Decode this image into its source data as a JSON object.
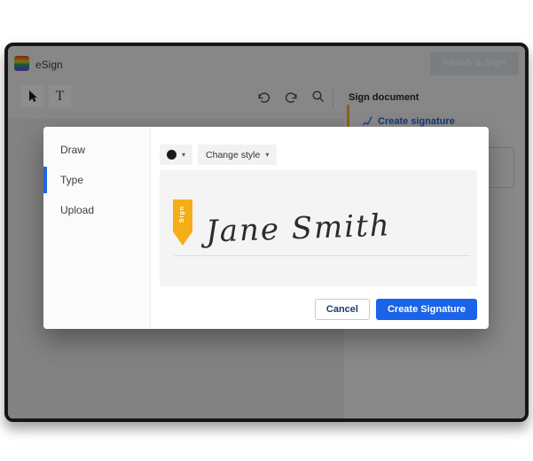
{
  "window": {
    "app_name": "eSign",
    "finish_button": "Finish & Sign"
  },
  "toolbar": {
    "text_tool": "T"
  },
  "panel": {
    "title": "Sign document",
    "create_signature_link": "Create signature"
  },
  "modal": {
    "tabs": [
      {
        "label": "Draw"
      },
      {
        "label": "Type"
      },
      {
        "label": "Upload"
      }
    ],
    "active_tab": "Type",
    "style_dropdown": "Change style",
    "signature_tag": "Sign",
    "signature_text": "Jane Smith",
    "cancel_button": "Cancel",
    "create_button": "Create Signature"
  },
  "icons": {
    "caret": "▾"
  },
  "colors": {
    "accent_blue": "#1b63e8",
    "indicator_blue": "#2063e5",
    "link_blue": "#2063e5",
    "tag_yellow": "#f5ad18",
    "panel_bar_yellow": "#f0b429",
    "selected_ink": "#1a1a1a"
  }
}
